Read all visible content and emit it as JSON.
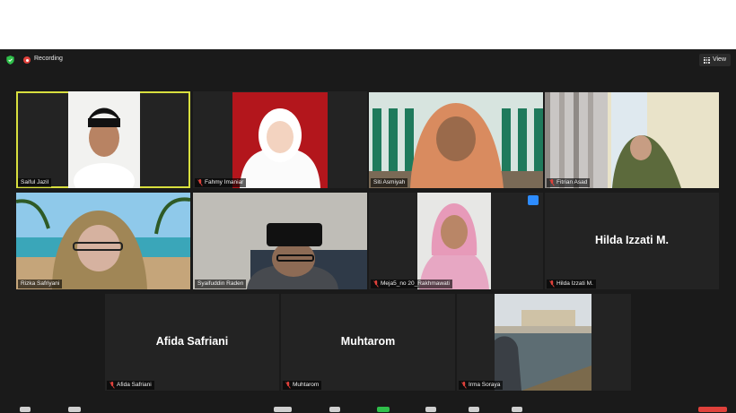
{
  "app": {
    "recording_label": "Recording",
    "view_label": "View"
  },
  "participants": [
    {
      "name": "Saiful Jazil",
      "muted": false,
      "video": true,
      "active_speaker": true
    },
    {
      "name": "Fahmy Imaniar",
      "muted": true,
      "video": true
    },
    {
      "name": "Siti Asmiyah",
      "muted": false,
      "video": true
    },
    {
      "name": "Fitrian Asad",
      "muted": true,
      "video": true
    },
    {
      "name": "Rizka Safriyani",
      "muted": false,
      "video": true
    },
    {
      "name": "Syaifuddin Raden",
      "muted": false,
      "video": true
    },
    {
      "name": "Meja5_no 20_Rakhmawati",
      "muted": true,
      "video": true
    },
    {
      "name": "Hilda Izzati M.",
      "display_name": "Hilda Izzati M.",
      "muted": true,
      "video": false
    },
    {
      "name": "Afida Safriani",
      "display_name": "Afida Safriani",
      "muted": true,
      "video": false
    },
    {
      "name": "Muhtarom",
      "display_name": "Muhtarom",
      "muted": true,
      "video": false
    },
    {
      "name": "Irma Soraya",
      "muted": true,
      "video": true
    }
  ],
  "colors": {
    "active_border": "#d8df3e",
    "recording": "#e0413b",
    "muted_mic": "#e0413b",
    "tile_bg": "#232323",
    "window_bg": "#1a1a1a"
  }
}
